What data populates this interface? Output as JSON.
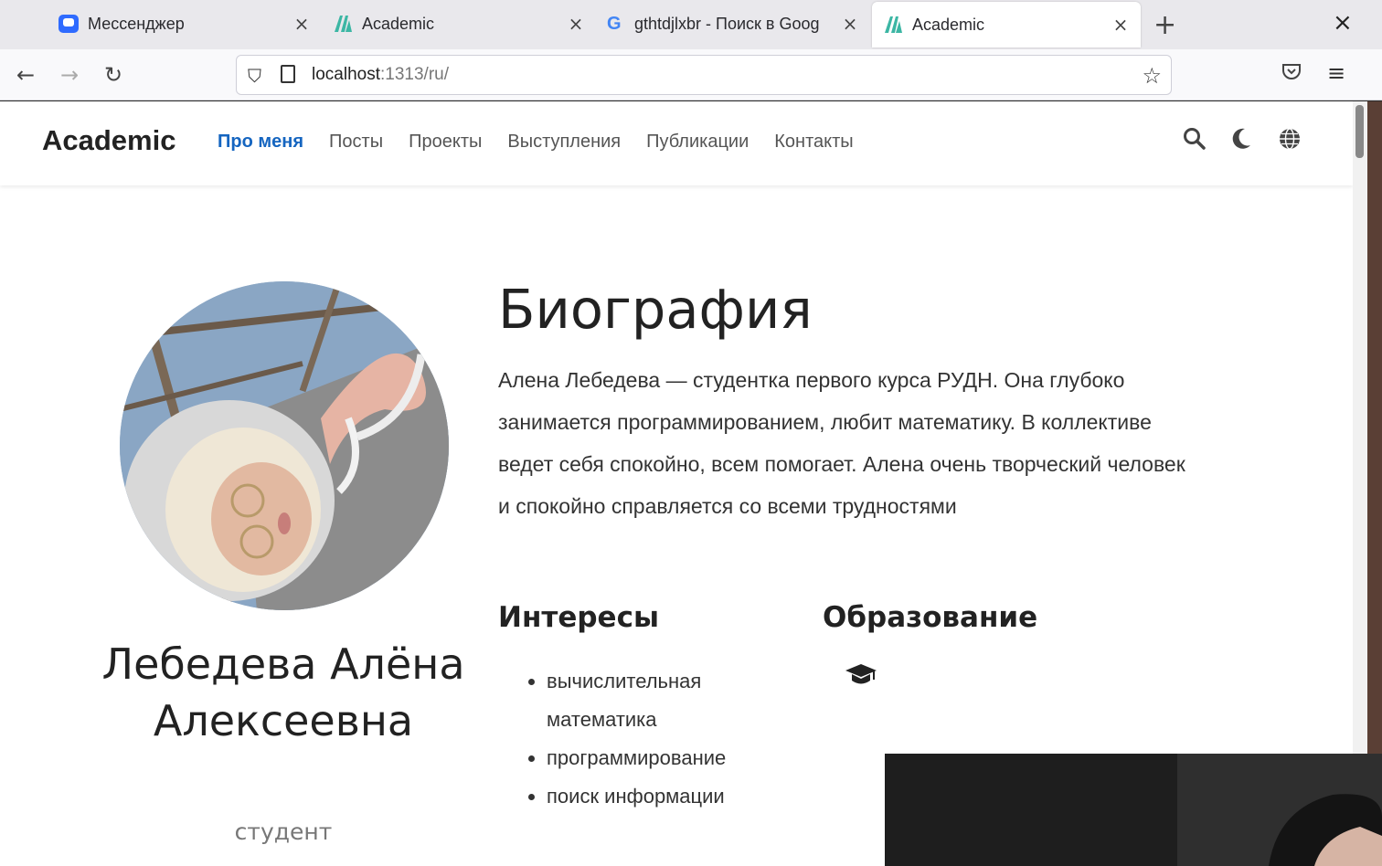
{
  "browser": {
    "tabs": [
      {
        "title": "Мессенджер",
        "icon": "messenger-icon",
        "active": false
      },
      {
        "title": "Academic",
        "icon": "academic-icon",
        "active": false
      },
      {
        "title": "gthtdjlxbr - Поиск в Goog",
        "icon": "google-icon",
        "active": false
      },
      {
        "title": "Academic",
        "icon": "academic-icon",
        "active": true
      }
    ],
    "url_host": "localhost",
    "url_rest": ":1313/ru/"
  },
  "site": {
    "brand": "Academic",
    "menu": [
      "Про меня",
      "Посты",
      "Проекты",
      "Выступления",
      "Публикации",
      "Контакты"
    ],
    "accent": "#1565c0"
  },
  "profile": {
    "name": "Лебедева Алёна Алексеевна",
    "role": "студент"
  },
  "bio": {
    "heading": "Биография",
    "text": "Алена Лебедева — студентка первого курса РУДН. Она глубоко занимается программированием, любит математику. В коллективе ведет себя спокойно, всем помогает. Алена очень творческий человек и спокойно справляется со всеми трудностями"
  },
  "interests": {
    "heading": "Интересы",
    "items": [
      "вычислительная математика",
      "программирование",
      "поиск информации"
    ]
  },
  "education": {
    "heading": "Образование",
    "icon": "graduation-cap-icon"
  }
}
